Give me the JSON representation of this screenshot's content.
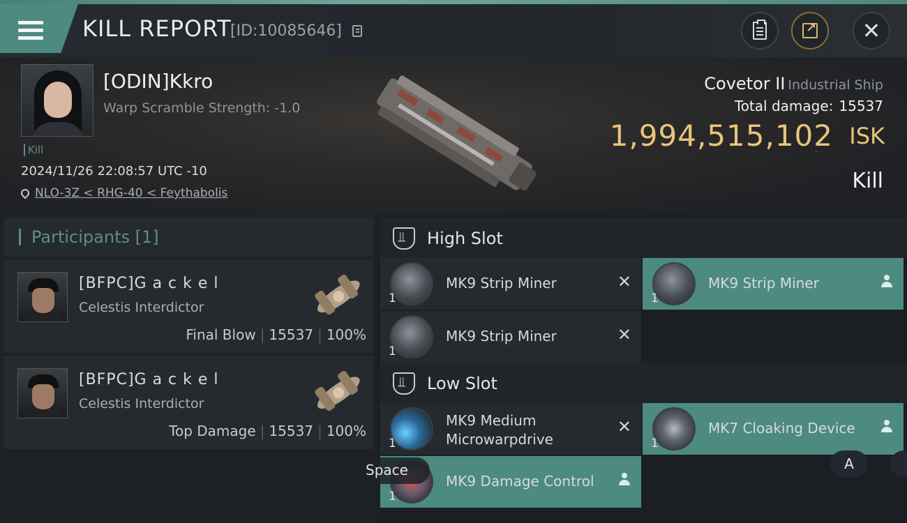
{
  "header": {
    "title": "KILL REPORT",
    "report_id": "[ID:10085646]"
  },
  "victim": {
    "pilot_name": "[ODIN]Kkro",
    "warp_scramble": "Warp Scramble Strength: -1.0",
    "tag": "Kill",
    "timestamp": "2024/11/26 22:08:57 UTC -10",
    "location": "NLO-3Z < RHG-40 < Feythabolis",
    "ship_name": "Covetor II",
    "ship_class": "Industrial Ship",
    "total_damage_label": "Total damage:",
    "total_damage": "15537",
    "isk_value": "1,994,515,102",
    "isk_unit": "ISK",
    "result": "Kill"
  },
  "participants": {
    "title": "Participants [1]",
    "items": [
      {
        "name": "[BFPC]G a c k e l",
        "ship": "Celestis Interdictor",
        "role": "Final Blow",
        "damage": "15537",
        "percent": "100%"
      },
      {
        "name": "[BFPC]G a c k e l",
        "ship": "Celestis Interdictor",
        "role": "Top Damage",
        "damage": "15537",
        "percent": "100%"
      }
    ]
  },
  "fitting": {
    "high_slot_title": "High Slot",
    "low_slot_title": "Low Slot",
    "high_modules": [
      {
        "name": "MK9 Strip Miner",
        "qty": "1",
        "state": "destroyed"
      },
      {
        "name": "MK9 Strip Miner",
        "qty": "1",
        "state": "dropped"
      },
      {
        "name": "MK9 Strip Miner",
        "qty": "1",
        "state": "destroyed"
      }
    ],
    "low_modules": [
      {
        "name": "MK9 Medium Microwarpdrive",
        "line1": "MK9 Medium",
        "line2": "Microwarpdrive",
        "qty": "1",
        "state": "destroyed"
      },
      {
        "name": "MK7 Cloaking Device",
        "qty": "1",
        "state": "dropped"
      },
      {
        "name": "MK9 Damage Control",
        "qty": "1",
        "state": "dropped"
      }
    ]
  },
  "overlay_keys": {
    "space": "Space",
    "a": "A"
  },
  "colors": {
    "accent": "#4d8a80",
    "isk": "#e8c57a",
    "panel": "#252a2f"
  }
}
